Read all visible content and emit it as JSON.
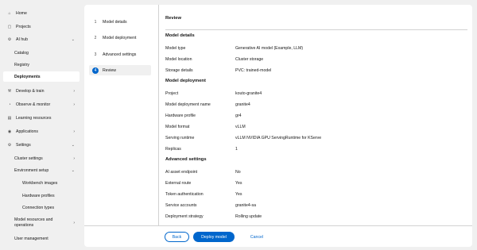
{
  "sidebar": {
    "items": [
      {
        "label": "Home",
        "icon": "home-icon",
        "glyph": "⌂"
      },
      {
        "label": "Projects",
        "icon": "folder-icon",
        "glyph": "▢"
      },
      {
        "label": "AI hub",
        "icon": "ai-hub-icon",
        "glyph": "⚙",
        "chevron": "⌄"
      },
      {
        "label": "Catalog"
      },
      {
        "label": "Registry"
      },
      {
        "label": "Deployments"
      },
      {
        "label": "Develop & train",
        "icon": "develop-icon",
        "glyph": "⚒",
        "chevron": "›"
      },
      {
        "label": "Observe & monitor",
        "icon": "monitor-icon",
        "glyph": "◔",
        "chevron": "›"
      },
      {
        "label": "Learning resources",
        "icon": "learning-icon",
        "glyph": "▤"
      },
      {
        "label": "Applications",
        "icon": "applications-icon",
        "glyph": "◉",
        "chevron": "›"
      },
      {
        "label": "Settings",
        "icon": "settings-icon",
        "glyph": "⚙",
        "chevron": "⌄"
      },
      {
        "label": "Cluster settings",
        "chevron": "›"
      },
      {
        "label": "Environment setup",
        "chevron": "⌄"
      },
      {
        "label": "Workbench images"
      },
      {
        "label": "Hardware profiles"
      },
      {
        "label": "Connection types"
      },
      {
        "label": "Model resources and operations",
        "chevron": "›"
      },
      {
        "label": "User management"
      }
    ]
  },
  "steps": [
    {
      "num": "1",
      "label": "Model details"
    },
    {
      "num": "2",
      "label": "Model deployment"
    },
    {
      "num": "3",
      "label": "Advanced settings"
    },
    {
      "num": "4",
      "label": "Review"
    }
  ],
  "review": {
    "title": "Review",
    "model_details": {
      "heading": "Model details",
      "rows": [
        {
          "k": "Model type",
          "v": "Generative AI model (Example, LLM)"
        },
        {
          "k": "Model location",
          "v": "Cluster storage"
        },
        {
          "k": "Storage details",
          "v": "PVC: trained-model"
        }
      ]
    },
    "model_deployment": {
      "heading": "Model deployment",
      "rows": [
        {
          "k": "Project",
          "v": "kouto-granite4"
        },
        {
          "k": "Model deployment name",
          "v": "granite4"
        },
        {
          "k": "Hardware profile",
          "v": "gr4"
        },
        {
          "k": "Model format",
          "v": "vLLM"
        },
        {
          "k": "Serving runtime",
          "v": "vLLM NVIDIA GPU ServingRuntime for KServe"
        },
        {
          "k": "Replicas",
          "v": "1"
        }
      ]
    },
    "advanced": {
      "heading": "Advanced settings",
      "rows": [
        {
          "k": "AI asset endpoint",
          "v": "No"
        },
        {
          "k": "External route",
          "v": "Yes"
        },
        {
          "k": "Token authentication",
          "v": "Yes"
        },
        {
          "k": "Service accounts",
          "v": "granite4-sa"
        },
        {
          "k": "Deployment strategy",
          "v": "Rolling update"
        }
      ]
    }
  },
  "footer": {
    "back": "Back",
    "deploy": "Deploy model",
    "cancel": "Cancel"
  },
  "colors": {
    "accent": "#0066cc",
    "background": "#f0f0f0"
  }
}
